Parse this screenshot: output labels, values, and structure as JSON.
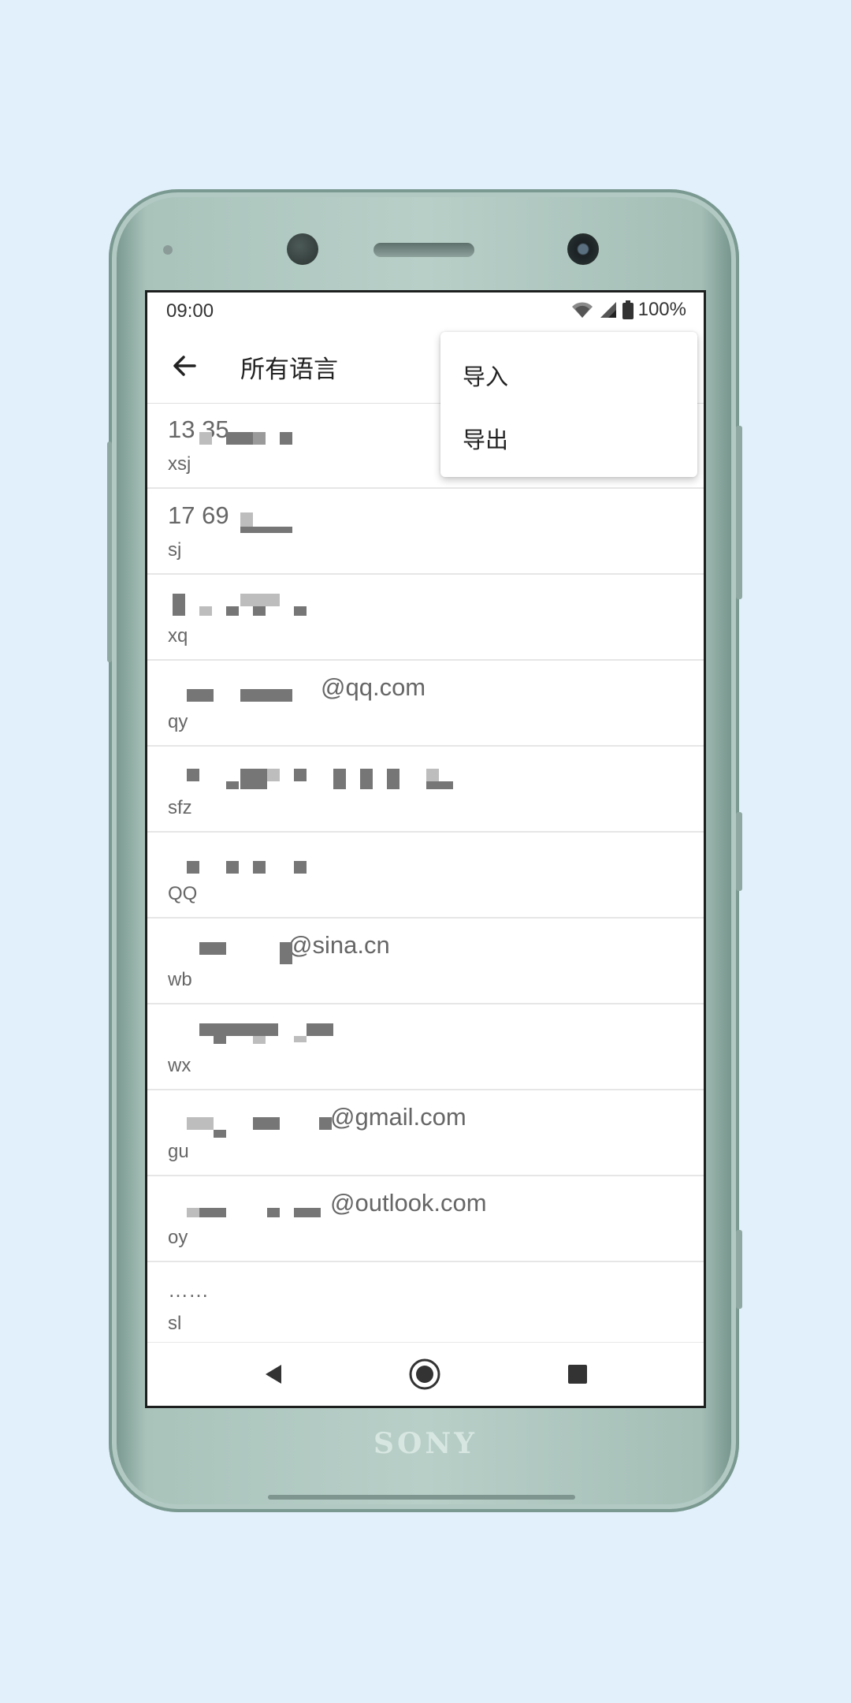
{
  "status_bar": {
    "time": "09:00",
    "battery": "100%",
    "icons": [
      "wifi-icon",
      "signal-icon",
      "battery-icon"
    ]
  },
  "app_bar": {
    "back_icon": "arrow-back-icon",
    "title": "所有语言"
  },
  "overflow_menu": {
    "items": [
      {
        "label": "导入"
      },
      {
        "label": "导出"
      }
    ]
  },
  "list": {
    "items": [
      {
        "value": "13          35",
        "key": "xsj"
      },
      {
        "value": "17           69",
        "key": "sj"
      },
      {
        "value": "",
        "key": "xq"
      },
      {
        "value": "@qq.com",
        "key": "qy"
      },
      {
        "value": "",
        "key": "sfz"
      },
      {
        "value": "",
        "key": "QQ"
      },
      {
        "value": "@sina.cn",
        "key": "wb"
      },
      {
        "value": "",
        "key": "wx"
      },
      {
        "value": "@gmail.com",
        "key": "gu"
      },
      {
        "value": "@outlook.com",
        "key": "oy"
      },
      {
        "value": "……",
        "key": "sl"
      }
    ]
  },
  "device": {
    "brand": "SONY"
  },
  "nav_bar": {
    "icons": [
      "back-triangle-icon",
      "home-circle-icon",
      "recents-square-icon"
    ]
  }
}
